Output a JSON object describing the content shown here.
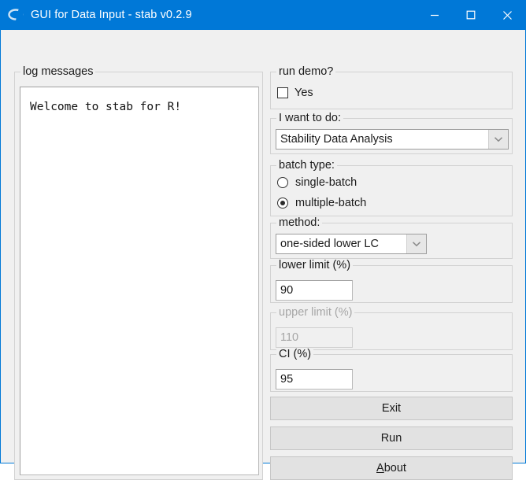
{
  "window": {
    "title": "GUI for Data Input - stab v0.2.9",
    "icon": "r-logo-icon",
    "accent_color": "#0078d7",
    "background_color": "#f0f0f0",
    "controls": {
      "minimize": "minimize-icon",
      "maximize": "maximize-icon",
      "close": "close-icon"
    }
  },
  "log_panel": {
    "label": "log messages",
    "text": "Welcome to stab for R!"
  },
  "run_demo": {
    "label": "run demo?",
    "checkbox_label": "Yes",
    "checked": false
  },
  "task": {
    "label": "I want to do:",
    "selected": "Stability Data Analysis",
    "arrow_icon": "chevron-down-icon"
  },
  "batch_type": {
    "label": "batch type:",
    "options": [
      {
        "label": "single-batch",
        "selected": false
      },
      {
        "label": "multiple-batch",
        "selected": true
      }
    ]
  },
  "method": {
    "label": "method:",
    "selected": "one-sided lower LC",
    "arrow_icon": "chevron-down-icon"
  },
  "lower_limit": {
    "label": "lower limit (%)",
    "value": "90",
    "disabled": false
  },
  "upper_limit": {
    "label": "upper limit (%)",
    "value": "110",
    "disabled": true
  },
  "ci": {
    "label": "CI (%)",
    "value": "95",
    "disabled": false
  },
  "buttons": {
    "exit": "Exit",
    "run": "Run",
    "about_accel": "A",
    "about_rest": "bout"
  }
}
